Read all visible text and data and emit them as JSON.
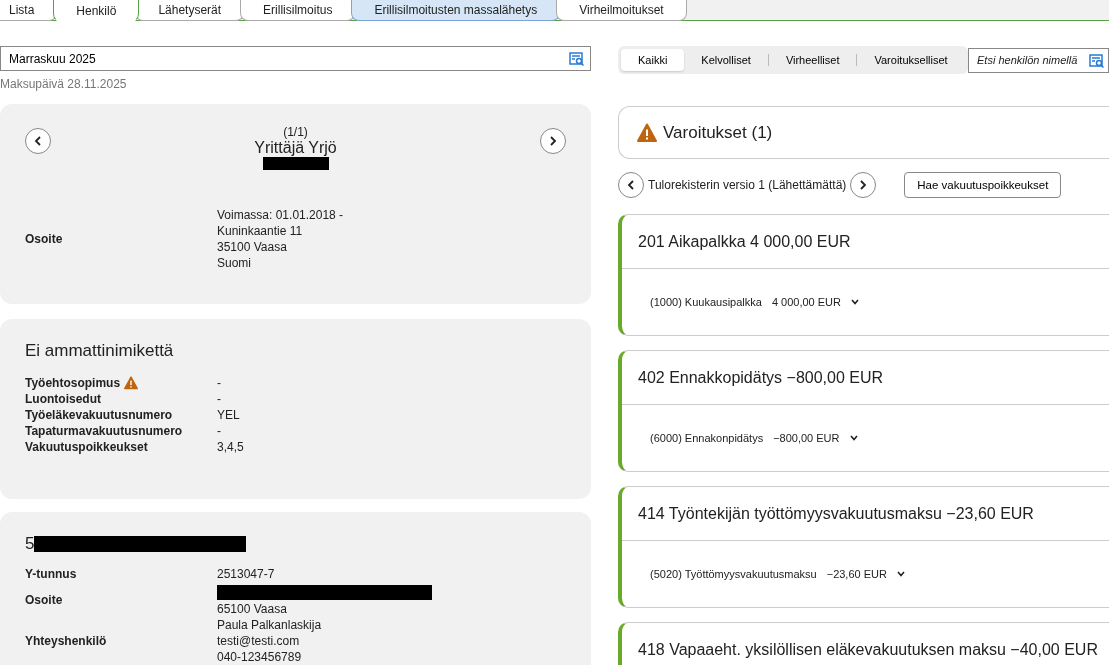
{
  "tabs": [
    {
      "label": "Lista",
      "selected": false,
      "highlighted": false
    },
    {
      "label": "Henkilö",
      "selected": true,
      "highlighted": false
    },
    {
      "label": "Lähetyserät",
      "selected": false,
      "highlighted": false
    },
    {
      "label": "Erillisilmoitus",
      "selected": false,
      "highlighted": false
    },
    {
      "label": "Erillisilmoitusten massalähetys",
      "selected": false,
      "highlighted": true
    },
    {
      "label": "Virheilmoitukset",
      "selected": false,
      "highlighted": false
    }
  ],
  "period_field": {
    "value": "Marraskuu 2025"
  },
  "payment_date": "Maksupäivä 28.11.2025",
  "filters": [
    {
      "label": "Kaikki",
      "selected": true
    },
    {
      "label": "Kelvolliset",
      "selected": false
    },
    {
      "label": "Virheelliset",
      "selected": false
    },
    {
      "label": "Varoitukselliset",
      "selected": false
    }
  ],
  "person_search": {
    "placeholder": "Etsi henkilön nimellä"
  },
  "person_card": {
    "counter": "(1/1)",
    "name": "Yrittäjä Yrjö",
    "name_redacted": true,
    "rows": [
      {
        "label": "Osoite",
        "lines": [
          "Voimassa: 01.01.2018 -",
          "Kuninkaantie 11",
          "35100 Vaasa",
          "Suomi"
        ]
      }
    ]
  },
  "employment_card": {
    "title": "Ei ammattinimikettä",
    "rows": [
      {
        "label": "Työehtosopimus",
        "warning": true,
        "lines": [
          "-"
        ]
      },
      {
        "label": "Luontoisedut",
        "lines": [
          "-"
        ]
      },
      {
        "label": "Työeläkevakuutusnumero",
        "lines": [
          "YEL"
        ]
      },
      {
        "label": "Tapaturmavakuutusnumero",
        "lines": [
          "-"
        ]
      },
      {
        "label": "Vakuutuspoikkeukset",
        "lines": [
          "3,4,5"
        ]
      }
    ]
  },
  "employer_card": {
    "title": "5",
    "title_redacted": true,
    "rows": [
      {
        "label": "Y-tunnus",
        "lines": [
          "2513047-7"
        ]
      },
      {
        "label": "Osoite",
        "redacted_first_line": true,
        "lines": [
          "65100 Vaasa"
        ]
      },
      {
        "label": "Yhteyshenkilö",
        "lines": [
          "Paula Palkanlaskija",
          "testi@testi.com",
          "040-123456789"
        ]
      }
    ]
  },
  "warnings": {
    "title": "Varoitukset (1)"
  },
  "version": {
    "label": "Tulorekisterin versio 1 (Lähettämättä)",
    "button": "Hae vakuutuspoikkeukset"
  },
  "income_items": [
    {
      "title": "201 Aikapalkka 4 000,00 EUR",
      "detail": "(1000) Kuukausipalkka",
      "amount": "4 000,00 EUR"
    },
    {
      "title": "402 Ennakkopidätys −800,00 EUR",
      "detail": "(6000) Ennakonpidätys",
      "amount": "−800,00 EUR"
    },
    {
      "title": "414 Työntekijän työttömyysvakuutusmaksu −23,60 EUR",
      "detail": "(5020) Työttömyysvakuutusmaksu",
      "amount": "−23,60 EUR"
    },
    {
      "title": "418 Vapaaeht. yksilöllisen eläkevakuutuksen maksu −40,00 EUR"
    }
  ]
}
